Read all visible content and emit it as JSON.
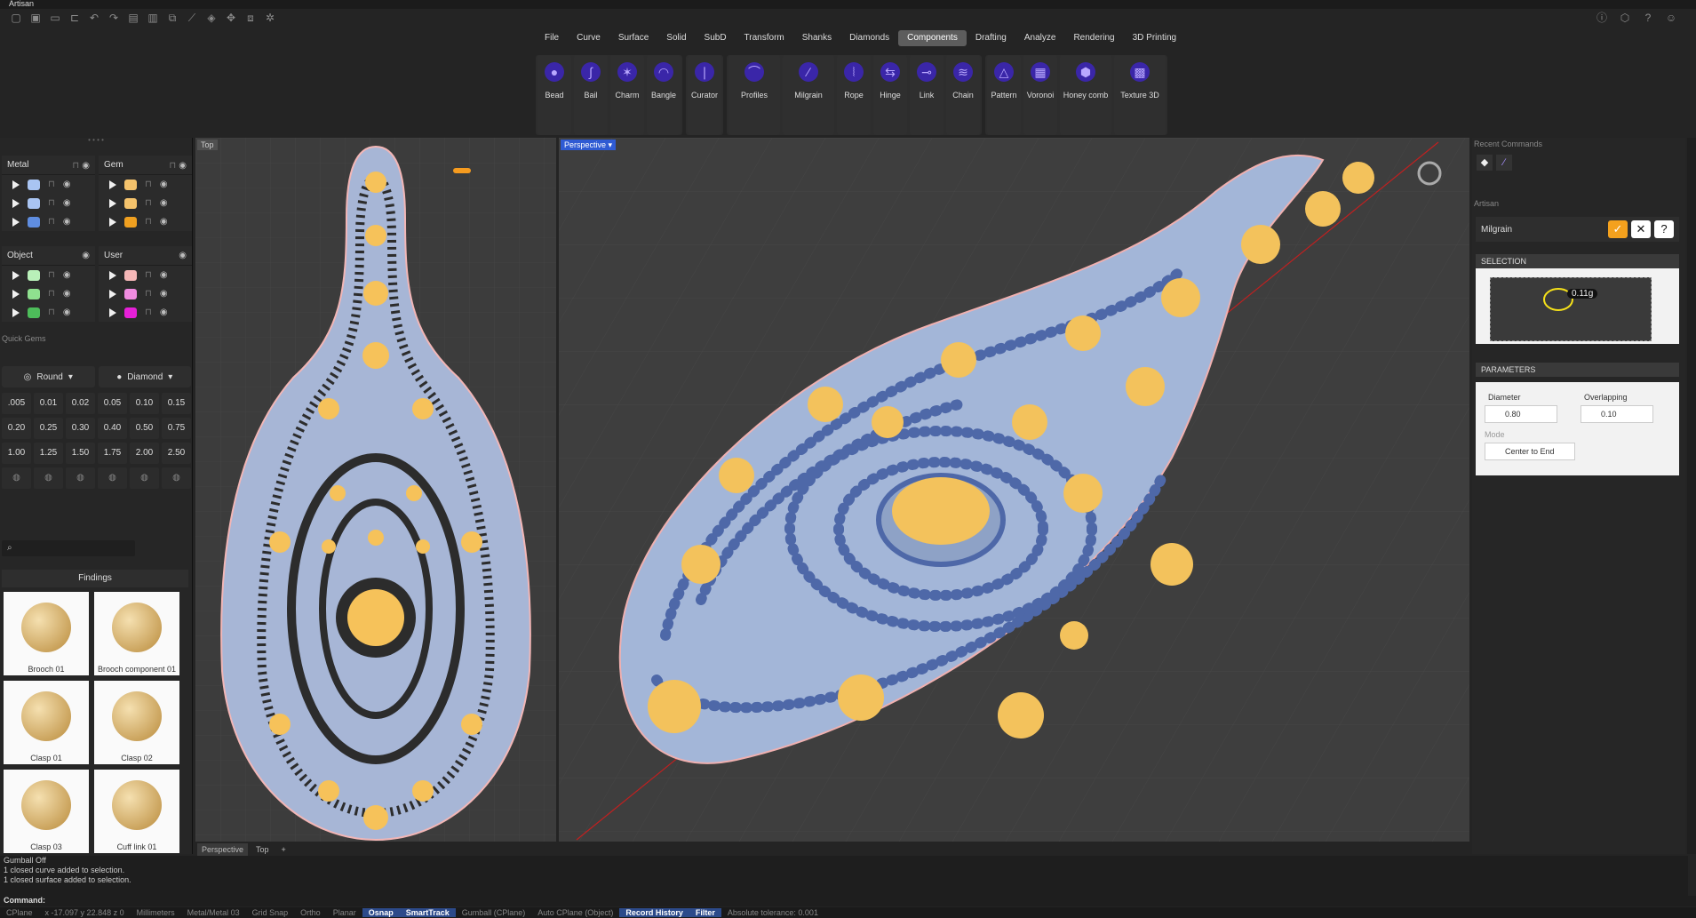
{
  "app": {
    "title": "Artisan"
  },
  "menu": [
    "File",
    "Curve",
    "Surface",
    "Solid",
    "SubD",
    "Transform",
    "Shanks",
    "Diamonds",
    "Components",
    "Drafting",
    "Analyze",
    "Rendering",
    "3D Printing"
  ],
  "menu_active": "Components",
  "ribbon": {
    "groups": [
      [
        "Bead",
        "Bail",
        "Charm",
        "Bangle"
      ],
      [
        "Curator"
      ],
      [
        "Profiles",
        "Milgrain",
        "Rope",
        "Hinge",
        "Link",
        "Chain"
      ],
      [
        "Pattern",
        "Voronoi",
        "Honey comb",
        "Texture 3D"
      ]
    ]
  },
  "layers": {
    "metal": {
      "title": "Metal",
      "colors": [
        "#a9c4f2",
        "#a9c4f2",
        "#5f8de0"
      ]
    },
    "gem": {
      "title": "Gem",
      "colors": [
        "#f5c36c",
        "#f5c36c",
        "#f0a020"
      ]
    },
    "object": {
      "title": "Object",
      "colors": [
        "#b9f0b9",
        "#8fe08f",
        "#4dbd5a"
      ]
    },
    "user": {
      "title": "User",
      "colors": [
        "#f5b7b7",
        "#f08ce0",
        "#e620d8"
      ]
    }
  },
  "quick_gems": {
    "title": "Quick Gems",
    "shape": "Round",
    "material": "Diamond",
    "sizes": [
      ".005",
      "0.01",
      "0.02",
      "0.05",
      "0.10",
      "0.15",
      "0.20",
      "0.25",
      "0.30",
      "0.40",
      "0.50",
      "0.75",
      "1.00",
      "1.25",
      "1.50",
      "1.75",
      "2.00",
      "2.50"
    ]
  },
  "library": {
    "category": "Findings",
    "items": [
      "Brooch 01",
      "Brooch component 01",
      "Clasp 01",
      "Clasp 02",
      "Clasp 03",
      "Cuff link 01"
    ]
  },
  "viewports": {
    "top_label": "Top",
    "persp_label": "Perspective",
    "tabs": [
      "Perspective",
      "Top",
      "+"
    ]
  },
  "right_panel": {
    "recent_title": "Recent Commands",
    "artisan_title": "Artisan",
    "command_name": "Milgrain",
    "selection_title": "SELECTION",
    "selection_value": "0.11g",
    "parameters_title": "PARAMETERS",
    "diameter_label": "Diameter",
    "diameter_value": "0.80",
    "overlap_label": "Overlapping",
    "overlap_value": "0.10",
    "mode_label": "Mode",
    "mode_value": "Center to End"
  },
  "history": [
    "Gumball Off",
    "1 closed curve added to selection.",
    "1 closed surface added to selection."
  ],
  "command_label": "Command:",
  "status": {
    "cplane": "CPlane",
    "coords": "x -17.097  y 22.848  z 0",
    "units": "Millimeters",
    "layer": "Metal/Metal 03",
    "toggles": [
      {
        "t": "Grid Snap",
        "on": false
      },
      {
        "t": "Ortho",
        "on": false
      },
      {
        "t": "Planar",
        "on": false
      },
      {
        "t": "Osnap",
        "on": true
      },
      {
        "t": "SmartTrack",
        "on": true
      },
      {
        "t": "Gumball (CPlane)",
        "on": false
      },
      {
        "t": "Auto CPlane (Object)",
        "on": false
      },
      {
        "t": "Record History",
        "on": true
      },
      {
        "t": "Filter",
        "on": true
      }
    ],
    "tolerance": "Absolute tolerance: 0.001"
  }
}
